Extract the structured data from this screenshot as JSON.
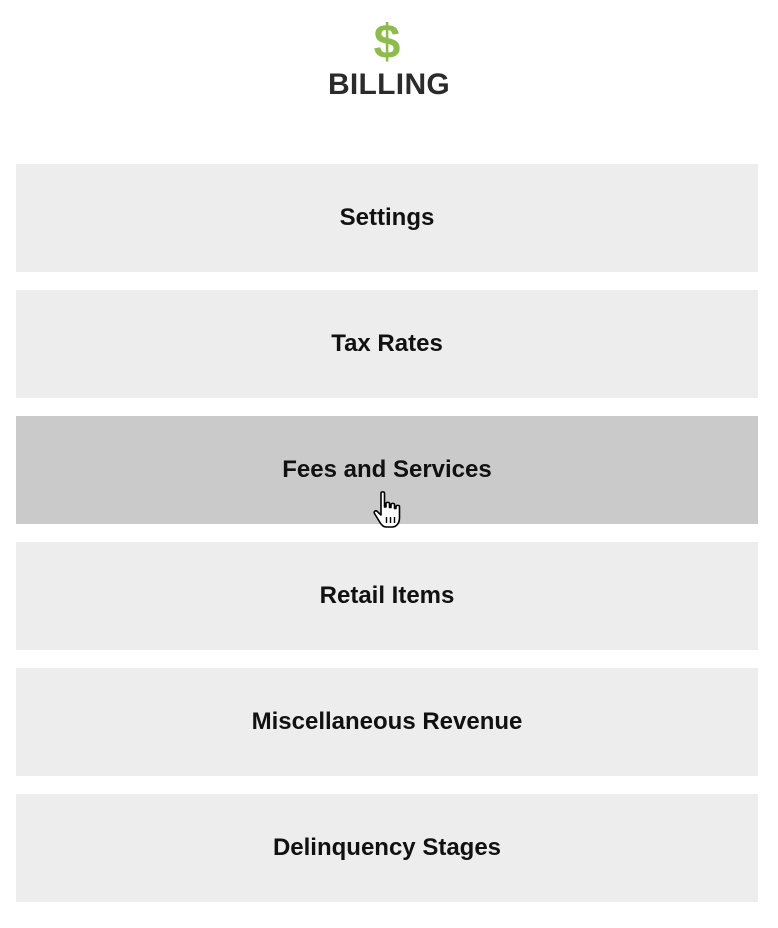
{
  "header": {
    "icon": "dollar-icon",
    "title": "BILLING",
    "icon_color": "#8dbb4c"
  },
  "menu": {
    "items": [
      {
        "label": "Settings",
        "active": false
      },
      {
        "label": "Tax Rates",
        "active": false
      },
      {
        "label": "Fees and Services",
        "active": true
      },
      {
        "label": "Retail Items",
        "active": false
      },
      {
        "label": "Miscellaneous Revenue",
        "active": false
      },
      {
        "label": "Delinquency Stages",
        "active": false
      }
    ]
  },
  "colors": {
    "item_bg": "#ededed",
    "item_hover_bg": "#cacaca",
    "text": "#111111"
  },
  "cursor": {
    "icon": "pointer-hand-icon"
  }
}
